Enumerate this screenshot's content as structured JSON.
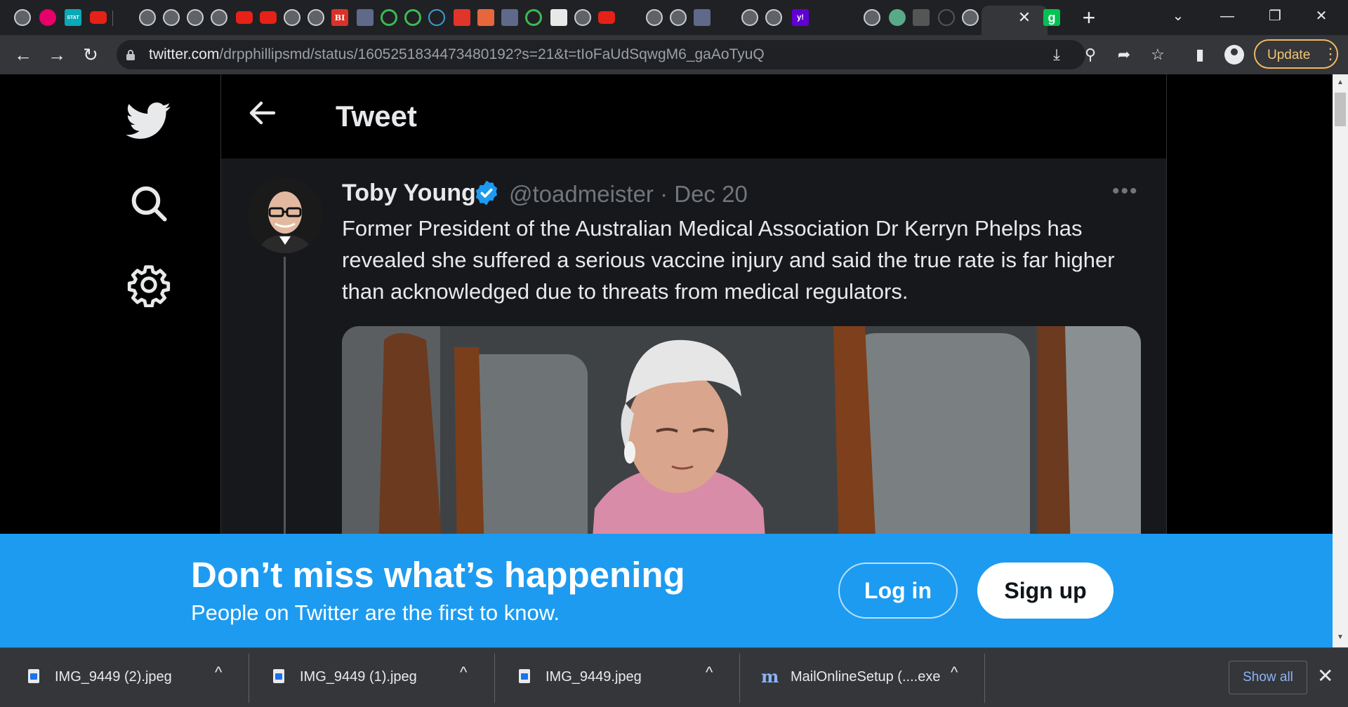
{
  "browser": {
    "tab_favicons": [
      "BI",
      "STAT",
      "y!",
      "g"
    ],
    "new_tab_symbol": "+",
    "tab_close_symbol": "✕",
    "window_controls": [
      "⌄",
      "—",
      "❐",
      "✕"
    ],
    "url_host": "twitter.com",
    "url_path": "/drpphillipsmd/status/1605251834473480192?s=21&t=tIoFaUdSqwgM6_gaAoTyuQ",
    "update_label": "Update",
    "update_menu_symbol": "⋮"
  },
  "page": {
    "header_title": "Tweet"
  },
  "tweet": {
    "author_name": "Toby Young",
    "author_handle": "@toadmeister · Dec 20",
    "more_symbol": "•••",
    "text": "Former President of the Australian Medical Association Dr Kerryn Phelps has revealed she suffered a serious vaccine injury and said the true rate is far higher than acknowledged due to threats from medical regulators."
  },
  "banner": {
    "title": "Don’t miss what’s happening",
    "subtitle": "People on Twitter are the first to know.",
    "login_label": "Log in",
    "signup_label": "Sign up"
  },
  "downloads": {
    "items": [
      {
        "name": "IMG_9449 (2).jpeg",
        "icon": "image-file-icon"
      },
      {
        "name": "IMG_9449 (1).jpeg",
        "icon": "image-file-icon"
      },
      {
        "name": "IMG_9449.jpeg",
        "icon": "image-file-icon"
      },
      {
        "name": "MailOnlineSetup (....exe",
        "icon": "mailonline-icon"
      }
    ],
    "mailonline_glyph": "m",
    "caret_symbol": "^",
    "show_all_label": "Show all",
    "close_symbol": "✕"
  },
  "colors": {
    "twitter_blue": "#1d9bf0",
    "background": "#000000",
    "text_primary": "#e7e9ea",
    "text_secondary": "#71767b"
  }
}
